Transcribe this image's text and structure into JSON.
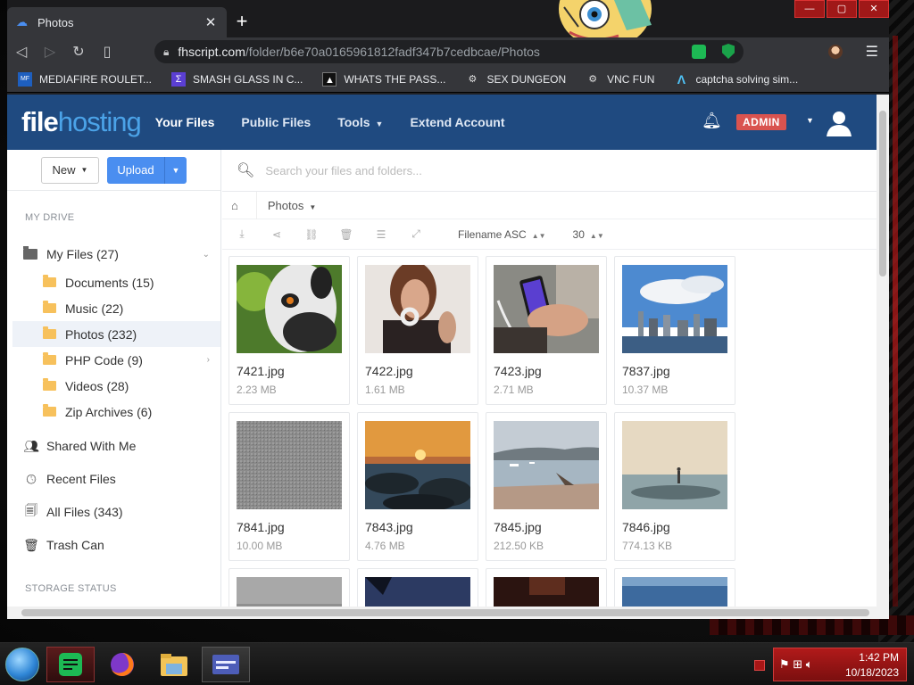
{
  "browser": {
    "tab_title": "Photos",
    "new_tab": "+",
    "url_domain": "fhscript.com",
    "url_path": "/folder/b6e70a0165961812fadf347b7cedbcae/Photos",
    "bookmarks": [
      {
        "label": "MEDIAFIRE ROULET...",
        "icon": "mediafire-icon"
      },
      {
        "label": "SMASH GLASS IN C...",
        "icon": "glass-icon"
      },
      {
        "label": "WHATS THE PASS...",
        "icon": "lock-icon"
      },
      {
        "label": "SEX DUNGEON",
        "icon": "gear-icon"
      },
      {
        "label": "VNC FUN",
        "icon": "gear-icon"
      },
      {
        "label": "captcha solving sim...",
        "icon": "lambda-icon"
      }
    ]
  },
  "site": {
    "logo_file": "file",
    "logo_hosting": "hosting",
    "nav": [
      {
        "label": "Your Files",
        "active": true
      },
      {
        "label": "Public Files",
        "active": false
      },
      {
        "label": "Tools",
        "active": false
      },
      {
        "label": "Extend Account",
        "active": false
      }
    ],
    "admin_badge": "ADMIN"
  },
  "sidebar": {
    "new_label": "New",
    "upload_label": "Upload",
    "section_drive": "MY DRIVE",
    "my_files": "My Files (27)",
    "folders": [
      {
        "label": "Documents (15)",
        "active": false
      },
      {
        "label": "Music (22)",
        "active": false
      },
      {
        "label": "Photos (232)",
        "active": true
      },
      {
        "label": "PHP Code (9)",
        "active": false
      },
      {
        "label": "Videos (28)",
        "active": false
      },
      {
        "label": "Zip Archives (6)",
        "active": false
      }
    ],
    "shared": "Shared With Me",
    "recent": "Recent Files",
    "all_files": "All Files (343)",
    "trash": "Trash Can",
    "section_storage": "STORAGE STATUS"
  },
  "main": {
    "search_placeholder": "Search your files and folders...",
    "breadcrumb_current": "Photos",
    "sort_label": "Filename ASC",
    "per_page": "30"
  },
  "files": [
    {
      "name": "7421.jpg",
      "size": "2.23 MB",
      "thumb": "lemur"
    },
    {
      "name": "7422.jpg",
      "size": "1.61 MB",
      "thumb": "woman-headphones"
    },
    {
      "name": "7423.jpg",
      "size": "2.71 MB",
      "thumb": "phone-hand"
    },
    {
      "name": "7837.jpg",
      "size": "10.37 MB",
      "thumb": "city-skyline"
    },
    {
      "name": "7841.jpg",
      "size": "10.00 MB",
      "thumb": "gray-texture"
    },
    {
      "name": "7843.jpg",
      "size": "4.76 MB",
      "thumb": "sunset-rocks"
    },
    {
      "name": "7845.jpg",
      "size": "212.50 KB",
      "thumb": "harbor-boats"
    },
    {
      "name": "7846.jpg",
      "size": "774.13 KB",
      "thumb": "person-sea"
    },
    {
      "name": "",
      "size": "",
      "thumb": "gray-fog"
    },
    {
      "name": "",
      "size": "",
      "thumb": "night-sky"
    },
    {
      "name": "",
      "size": "",
      "thumb": "dark-room"
    },
    {
      "name": "",
      "size": "",
      "thumb": "ocean-waves"
    }
  ],
  "taskbar": {
    "time": "1:42 PM",
    "date": "10/18/2023"
  },
  "colors": {
    "header": "#1f4a80",
    "accent": "#4a8ef0",
    "admin": "#d9534f",
    "tray": "#b11a1a"
  }
}
